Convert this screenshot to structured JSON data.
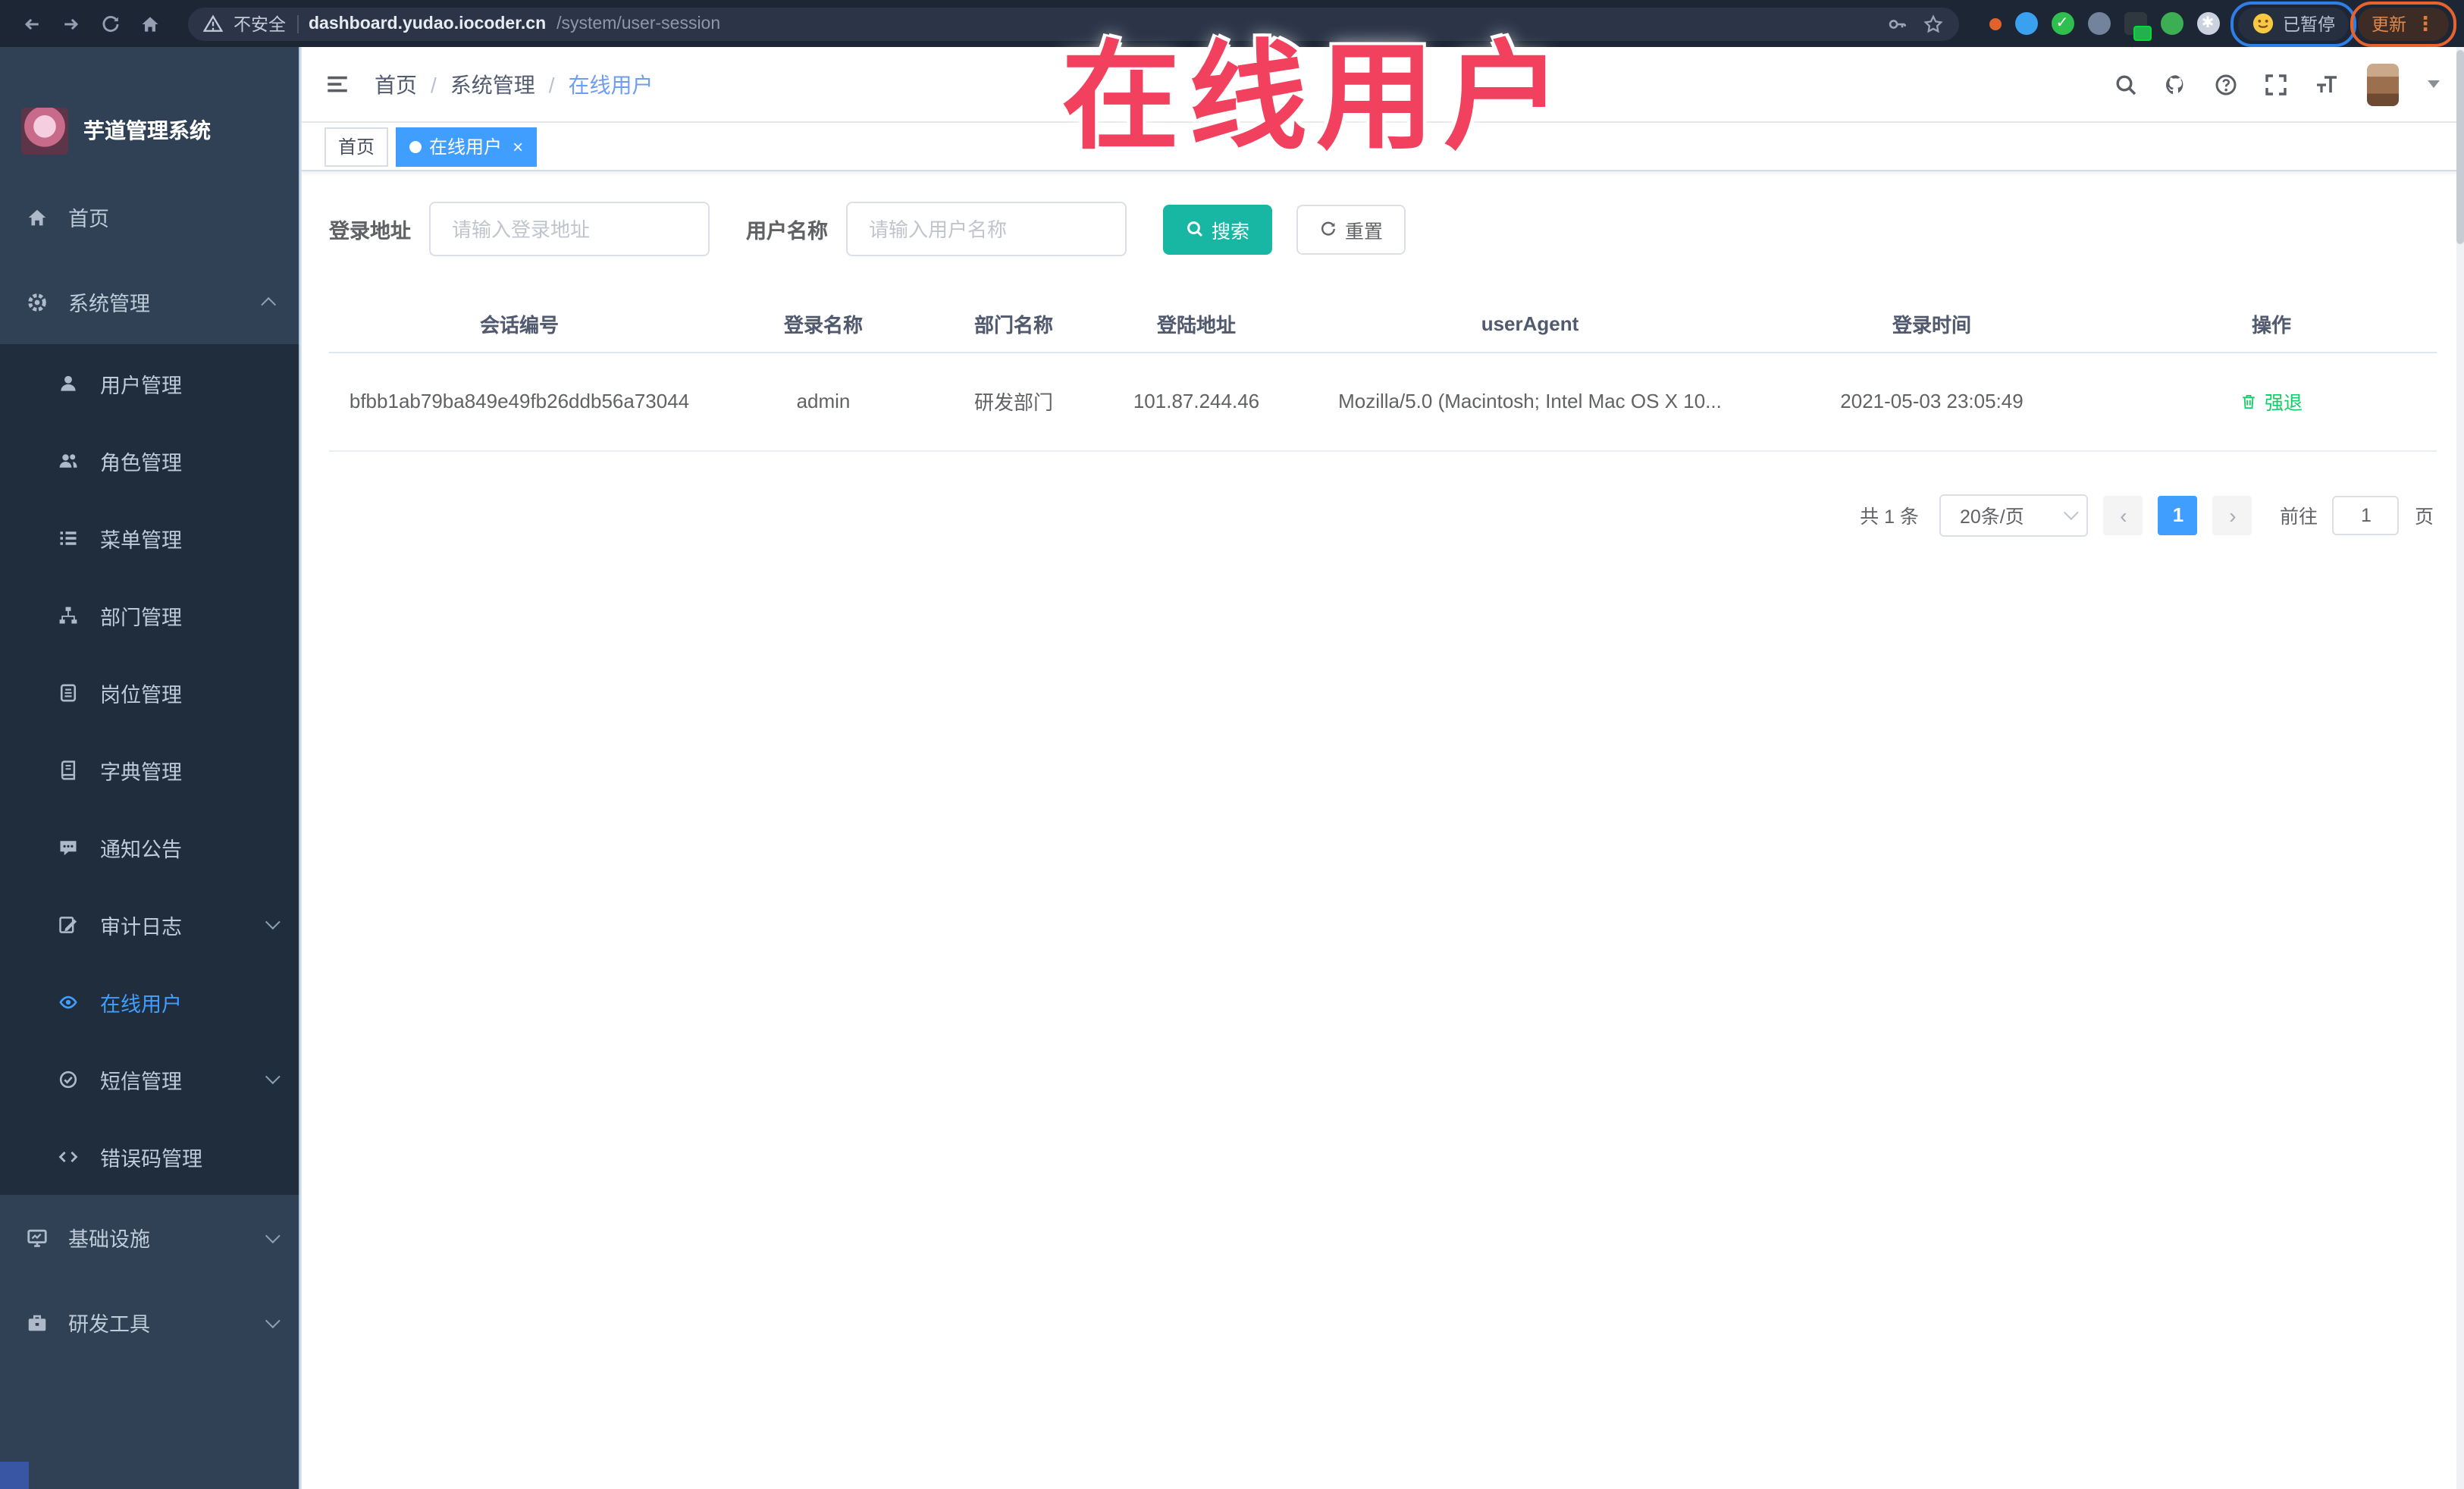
{
  "colors": {
    "accent": "#409eff",
    "search_button": "#18b7a4",
    "action_green": "#13ce66",
    "annotation_red": "#f2415e",
    "sidebar_bg": "#304156",
    "sidebar_submenu_bg": "#1f2d3d"
  },
  "annotation": {
    "title": "在线用户"
  },
  "browser": {
    "security_label": "不安全",
    "url_host": "dashboard.yudao.iocoder.cn",
    "url_path": "/system/user-session",
    "paused_label": "已暂停",
    "update_label": "更新",
    "kebab_glyph": "⋮",
    "ext_check_glyph": "✓",
    "ext_puzzle_glyph": "✱"
  },
  "sidebar": {
    "app_title": "芋道管理系统",
    "items": [
      {
        "label": "首页"
      },
      {
        "label": "系统管理"
      },
      {
        "label": "用户管理"
      },
      {
        "label": "角色管理"
      },
      {
        "label": "菜单管理"
      },
      {
        "label": "部门管理"
      },
      {
        "label": "岗位管理"
      },
      {
        "label": "字典管理"
      },
      {
        "label": "通知公告"
      },
      {
        "label": "审计日志"
      },
      {
        "label": "在线用户",
        "active": true
      },
      {
        "label": "短信管理"
      },
      {
        "label": "错误码管理"
      },
      {
        "label": "基础设施"
      },
      {
        "label": "研发工具"
      }
    ]
  },
  "header": {
    "breadcrumb": [
      {
        "label": "首页"
      },
      {
        "label": "系统管理"
      },
      {
        "label": "在线用户"
      }
    ],
    "separator": "/"
  },
  "tags": [
    {
      "label": "首页"
    },
    {
      "label": "在线用户",
      "close_glyph": "×"
    }
  ],
  "filters": {
    "login_address_label": "登录地址",
    "login_address_placeholder": "请输入登录地址",
    "username_label": "用户名称",
    "username_placeholder": "请输入用户名称",
    "search_label": "搜索",
    "reset_label": "重置"
  },
  "table": {
    "columns": [
      "会话编号",
      "登录名称",
      "部门名称",
      "登陆地址",
      "userAgent",
      "登录时间",
      "操作"
    ],
    "row": {
      "session_id": "bfbb1ab79ba849e49fb26ddb56a73044",
      "username": "admin",
      "dept_name": "研发部门",
      "login_ip": "101.87.244.46",
      "user_agent": "Mozilla/5.0 (Macintosh; Intel Mac OS X 10...",
      "login_time": "2021-05-03 23:05:49",
      "action_label": "强退"
    }
  },
  "pagination": {
    "total_label": "共 1 条",
    "page_size_label": "20条/页",
    "prev_glyph": "‹",
    "next_glyph": "›",
    "current_page": "1",
    "goto_label": "前往",
    "goto_value": "1",
    "page_unit_label": "页"
  }
}
